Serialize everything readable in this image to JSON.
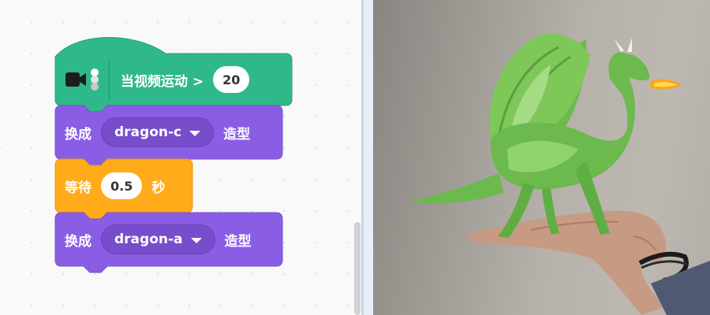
{
  "blocks": {
    "hat": {
      "label": "当视频运动 >",
      "value": "20",
      "icon": "video-camera-icon",
      "color": "#2fb88a"
    },
    "switch_costume_1": {
      "prefix": "换成",
      "costume": "dragon-c",
      "suffix": "造型",
      "color": "#8a5ee4"
    },
    "wait": {
      "prefix": "等待",
      "value": "0.5",
      "suffix": "秒",
      "color": "#ffab1a"
    },
    "switch_costume_2": {
      "prefix": "换成",
      "costume": "dragon-a",
      "suffix": "造型",
      "color": "#8a5ee4"
    }
  },
  "stage": {
    "sprite": "dragon-sprite",
    "backdrop": "video-feed-hand"
  }
}
